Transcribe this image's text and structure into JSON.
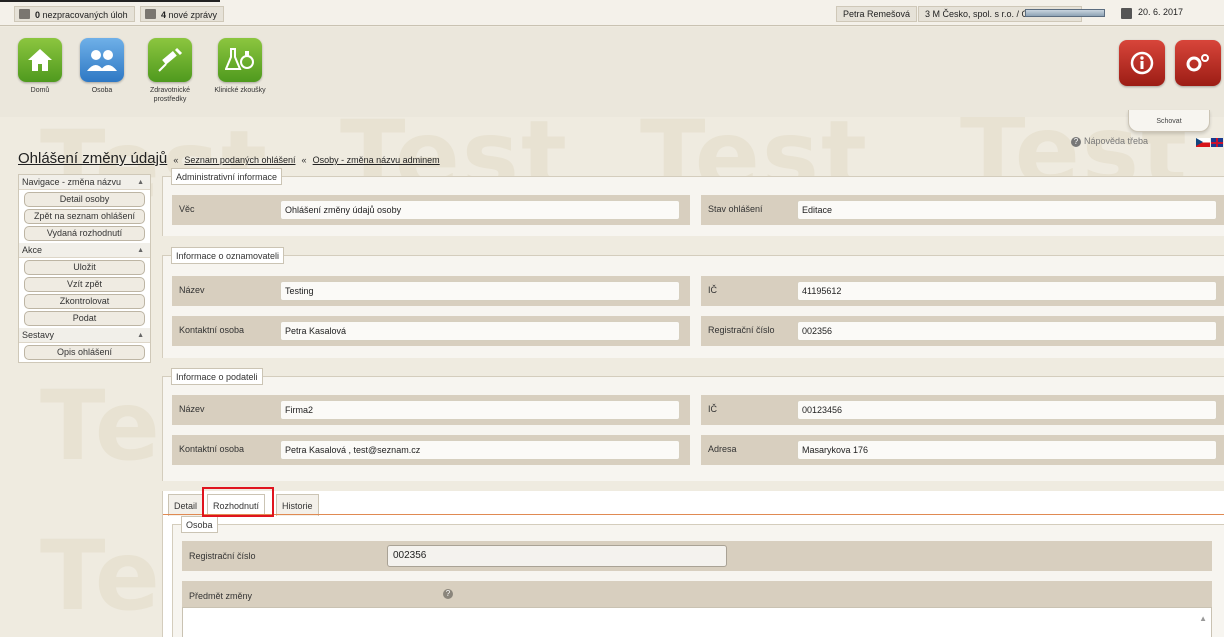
{
  "topbar": {
    "unprocessed_count": "0",
    "unprocessed_label": "nezpracovaných úloh",
    "messages_count": "4",
    "messages_label": "nové zprávy",
    "user_name": "Petra Remešová",
    "organization": "3 M Česko, spol. s r.o. / Oznamovatel",
    "date": "20. 6. 2017"
  },
  "apps": [
    {
      "label": "Domů",
      "icon": "house-icon"
    },
    {
      "label": "Osoba",
      "icon": "people-icon"
    },
    {
      "label": "Zdravotnické prostředky",
      "icon": "syringe-icon"
    },
    {
      "label": "Klinické zkoušky",
      "icon": "flask-icon"
    }
  ],
  "right_tools": {
    "info_icon": "info-icon",
    "settings_icon": "gears-icon"
  },
  "hide_label": "Schovat",
  "help_label": "Nápověda třeba",
  "watermark": "Test",
  "breadcrumb": {
    "title": "Ohlášení změny údajů",
    "link1": "Seznam podaných ohlášení",
    "link2": "Osoby - změna názvu adminem",
    "separator": "«"
  },
  "nav": {
    "sections": [
      {
        "title": "Navigace - změna názvu",
        "items": [
          "Detail osoby",
          "Zpět na seznam ohlášení",
          "Vydaná rozhodnutí"
        ]
      },
      {
        "title": "Akce",
        "items": [
          "Uložit",
          "Vzít zpět",
          "Zkontrolovat",
          "Podat"
        ]
      },
      {
        "title": "Sestavy",
        "items": [
          "Opis ohlášení"
        ]
      }
    ]
  },
  "admin": {
    "legend": "Administrativní informace",
    "subject_label": "Věc",
    "subject_value": "Ohlášení změny údajů osoby",
    "state_label": "Stav ohlášení",
    "state_value": "Editace"
  },
  "notifier": {
    "legend": "Informace o oznamovateli",
    "name_label": "Název",
    "name_value": "Testing",
    "ic_label": "IČ",
    "ic_value": "41195612",
    "contact_label": "Kontaktní osoba",
    "contact_value": "Petra Kasalová",
    "reg_label": "Registrační číslo",
    "reg_value": "002356"
  },
  "submitter": {
    "legend": "Informace o podateli",
    "name_label": "Název",
    "name_value": "Firma2",
    "ic_label": "IČ",
    "ic_value": "00123456",
    "contact_label": "Kontaktní osoba",
    "contact_value": "Petra Kasalová , test@seznam.cz",
    "address_label": "Adresa",
    "address_value": "Masarykova 176"
  },
  "tabs": [
    "Detail",
    "Rozhodnutí",
    "Historie"
  ],
  "person": {
    "legend": "Osoba",
    "reg_label": "Registrační číslo",
    "reg_value": "002356",
    "subject_label": "Předmět změny"
  },
  "colors": {
    "accent_tab_border": "#e0141e",
    "tab_underline": "#e08a52",
    "row_bg": "#d8cfbf"
  }
}
